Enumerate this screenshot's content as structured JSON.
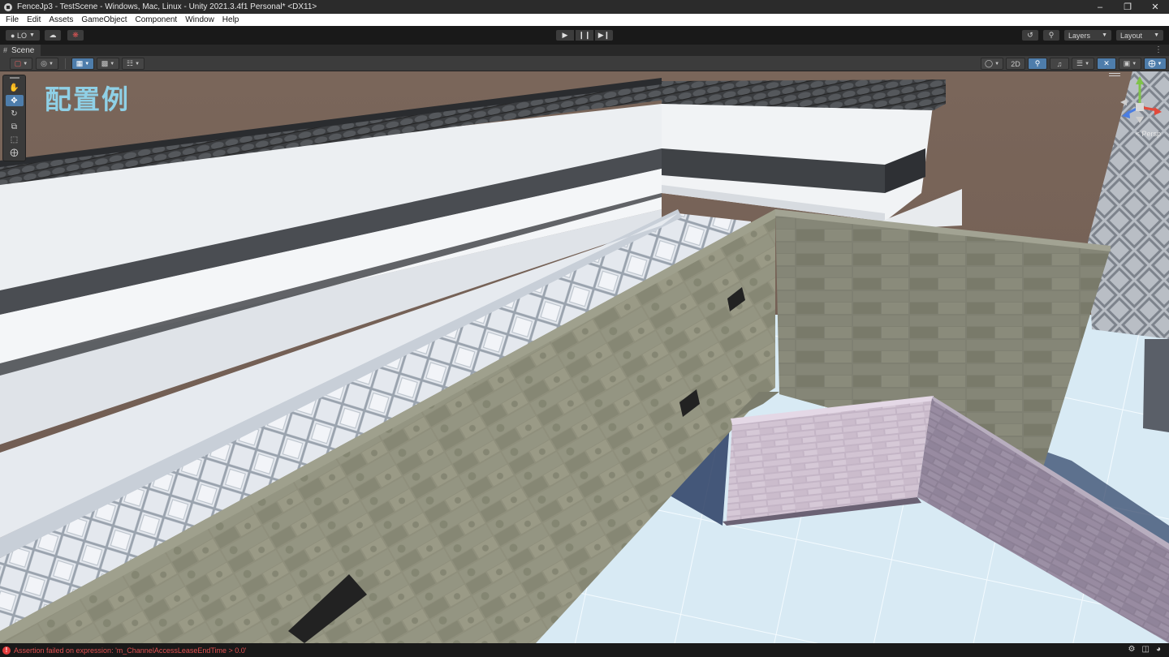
{
  "window": {
    "title": "FenceJp3 - TestScene - Windows, Mac, Linux - Unity 2021.3.4f1 Personal* <DX11>",
    "controls": [
      "minimize",
      "restore",
      "close"
    ]
  },
  "menubar": {
    "items": [
      "File",
      "Edit",
      "Assets",
      "GameObject",
      "Component",
      "Window",
      "Help"
    ]
  },
  "toolbar": {
    "account_label": "LO",
    "layers_label": "Layers",
    "layout_label": "Layout",
    "play_controls": [
      "play",
      "pause",
      "step"
    ]
  },
  "scene_tab": {
    "label": "Scene"
  },
  "scene_toolbar": {
    "mode_2d_label": "2D"
  },
  "viewport": {
    "caption": "配置例",
    "projection_label": "< Persp",
    "tools": [
      "hand-tool",
      "move-tool",
      "rotate-tool",
      "scale-tool",
      "rect-tool",
      "transform-tool"
    ],
    "active_tool": "move-tool"
  },
  "statusbar": {
    "message": "Assertion failed on expression: 'm_ChannelAccessLeaseEndTime > 0.0'",
    "level": "error"
  },
  "colors": {
    "caption": "#8fd0e6",
    "active_button": "#4e7dab",
    "error_text": "#e05050",
    "sky": "#7d685c",
    "floor": "#dcecf4"
  }
}
